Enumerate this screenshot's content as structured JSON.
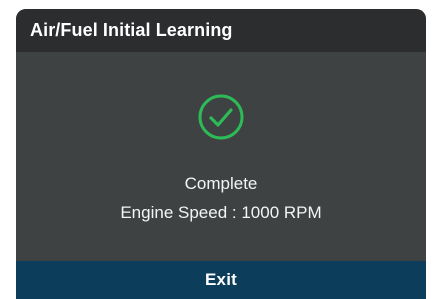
{
  "dialog": {
    "title": "Air/Fuel Initial Learning",
    "status_icon": "check-circle-icon",
    "status": "Complete",
    "engine_speed": "Engine Speed : 1000 RPM",
    "exit_label": "Exit"
  },
  "colors": {
    "header_background": "#2b2d2e",
    "body_background": "#3f4243",
    "exit_button_background": "#0c3d5a",
    "success_green": "#2dbb58",
    "text": "#f3f5f5"
  }
}
